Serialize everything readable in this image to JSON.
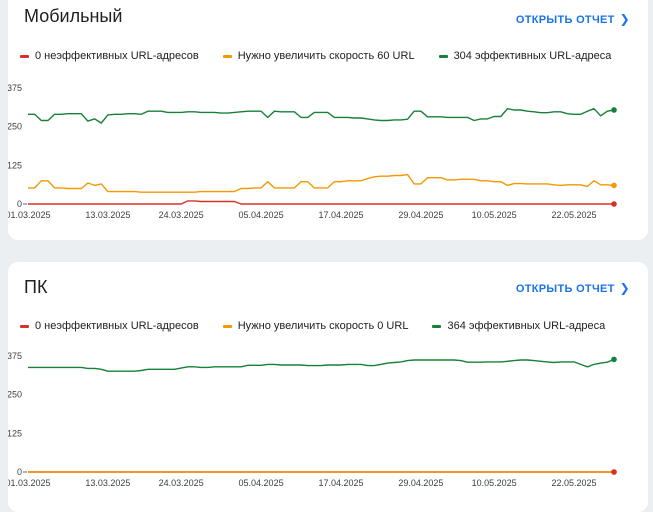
{
  "cards": [
    {
      "title": "Мобильный",
      "link_label": "ОТКРЫТЬ ОТЧЕТ",
      "legend": [
        {
          "label": "0 неэффективных URL-адресов",
          "color": "#d93025"
        },
        {
          "label": "Нужно увеличить скорость 60 URL",
          "color": "#f29900"
        },
        {
          "label": "304 эффективных URL-адреса",
          "color": "#188038"
        }
      ]
    },
    {
      "title": "ПК",
      "link_label": "ОТКРЫТЬ ОТЧЕТ",
      "legend": [
        {
          "label": "0 неэффективных URL-адресов",
          "color": "#d93025"
        },
        {
          "label": "Нужно увеличить скорость 0 URL",
          "color": "#f29900"
        },
        {
          "label": "364 эффективных URL-адреса",
          "color": "#188038"
        }
      ]
    }
  ],
  "chart_data": [
    {
      "type": "line",
      "ylim": [
        0,
        375
      ],
      "yticks": [
        "375",
        "250",
        "125",
        "0"
      ],
      "ytick_values": [
        375,
        250,
        125,
        0
      ],
      "x_tick_labels": [
        "01.03.2025",
        "13.03.2025",
        "24.03.2025",
        "05.04.2025",
        "17.04.2025",
        "29.04.2025",
        "10.05.2025",
        "22.05.2025"
      ],
      "x_tick_indices": [
        0,
        12,
        23,
        35,
        47,
        59,
        70,
        82
      ],
      "grid": false,
      "series": [
        {
          "name": "0 неэффективных URL-адресов",
          "color": "#d93025",
          "values": [
            0,
            0,
            0,
            0,
            0,
            0,
            0,
            0,
            0,
            0,
            0,
            0,
            0,
            0,
            0,
            0,
            0,
            0,
            0,
            0,
            0,
            0,
            0,
            0,
            10,
            10,
            8,
            8,
            8,
            8,
            8,
            8,
            0,
            0,
            0,
            0,
            0,
            0,
            0,
            0,
            0,
            0,
            0,
            0,
            0,
            0,
            0,
            0,
            0,
            0,
            0,
            0,
            0,
            0,
            0,
            0,
            0,
            0,
            0,
            0,
            0,
            0,
            0,
            0,
            0,
            0,
            0,
            0,
            0,
            0,
            0,
            0,
            0,
            0,
            0,
            0,
            0,
            0,
            0,
            0,
            0,
            0,
            0,
            0,
            0,
            0,
            0,
            0,
            0
          ]
        },
        {
          "name": "Нужно увеличить скорость 60 URL",
          "color": "#f29900",
          "values": [
            52,
            52,
            75,
            75,
            52,
            52,
            50,
            50,
            50,
            68,
            60,
            65,
            40,
            40,
            40,
            40,
            40,
            38,
            38,
            38,
            38,
            38,
            38,
            38,
            38,
            38,
            40,
            40,
            40,
            40,
            40,
            40,
            50,
            50,
            52,
            52,
            72,
            52,
            52,
            52,
            52,
            72,
            72,
            52,
            52,
            52,
            72,
            72,
            75,
            75,
            75,
            82,
            88,
            90,
            90,
            92,
            92,
            95,
            65,
            65,
            85,
            85,
            85,
            78,
            78,
            80,
            80,
            80,
            75,
            75,
            72,
            72,
            60,
            66,
            66,
            65,
            65,
            65,
            65,
            62,
            60,
            62,
            62,
            62,
            57,
            75,
            62,
            62,
            60
          ]
        },
        {
          "name": "304 эффективных URL-адреса",
          "color": "#188038",
          "values": [
            290,
            290,
            270,
            270,
            290,
            290,
            292,
            292,
            292,
            268,
            275,
            262,
            288,
            290,
            290,
            292,
            292,
            290,
            300,
            300,
            300,
            296,
            296,
            296,
            298,
            298,
            296,
            296,
            296,
            294,
            294,
            296,
            298,
            300,
            300,
            300,
            280,
            300,
            298,
            298,
            298,
            280,
            280,
            296,
            296,
            296,
            280,
            280,
            280,
            278,
            278,
            275,
            272,
            270,
            270,
            272,
            272,
            274,
            300,
            300,
            282,
            282,
            282,
            280,
            280,
            280,
            280,
            270,
            275,
            275,
            283,
            283,
            308,
            304,
            304,
            300,
            298,
            295,
            295,
            298,
            298,
            292,
            290,
            290,
            300,
            308,
            285,
            300,
            304
          ]
        }
      ]
    },
    {
      "type": "line",
      "ylim": [
        0,
        375
      ],
      "yticks": [
        "375",
        "250",
        "125",
        "0"
      ],
      "ytick_values": [
        375,
        250,
        125,
        0
      ],
      "x_tick_labels": [
        "01.03.2025",
        "13.03.2025",
        "24.03.2025",
        "05.04.2025",
        "17.04.2025",
        "29.04.2025",
        "10.05.2025",
        "22.05.2025"
      ],
      "x_tick_indices": [
        0,
        12,
        23,
        35,
        47,
        59,
        70,
        82
      ],
      "grid": false,
      "series": [
        {
          "name": "0 неэффективных URL-адресов",
          "color": "#d93025",
          "values": [
            0,
            0,
            0,
            0,
            0,
            0,
            0,
            0,
            0,
            0,
            0,
            0,
            0,
            0,
            0,
            0,
            0,
            0,
            0,
            0,
            0,
            0,
            0,
            0,
            0,
            0,
            0,
            0,
            0,
            0,
            0,
            0,
            0,
            0,
            0,
            0,
            0,
            0,
            0,
            0,
            0,
            0,
            0,
            0,
            0,
            0,
            0,
            0,
            0,
            0,
            0,
            0,
            0,
            0,
            0,
            0,
            0,
            0,
            0,
            0,
            0,
            0,
            0,
            0,
            0,
            0,
            0,
            0,
            0,
            0,
            0,
            0,
            0,
            0,
            0,
            0,
            0,
            0,
            0,
            0,
            0,
            0,
            0,
            0,
            0,
            0,
            0,
            0,
            0
          ]
        },
        {
          "name": "Нужно увеличить скорость 0 URL",
          "color": "#f29900",
          "values": [
            0,
            0,
            0,
            0,
            0,
            0,
            0,
            0,
            0,
            0,
            0,
            0,
            0,
            0,
            0,
            0,
            0,
            0,
            0,
            0,
            0,
            0,
            0,
            0,
            0,
            0,
            0,
            0,
            0,
            0,
            0,
            0,
            0,
            0,
            0,
            0,
            0,
            0,
            0,
            0,
            0,
            0,
            0,
            0,
            0,
            0,
            0,
            0,
            0,
            0,
            0,
            0,
            0,
            0,
            0,
            0,
            0,
            0,
            0,
            0,
            0,
            0,
            0,
            0,
            0,
            0,
            0,
            0,
            0,
            0,
            0,
            0,
            0,
            0,
            0,
            0,
            0,
            0,
            0,
            0,
            0,
            0,
            0,
            0,
            0,
            0,
            0,
            0,
            0
          ]
        },
        {
          "name": "364 эффективных URL-адреса",
          "color": "#188038",
          "values": [
            338,
            338,
            338,
            338,
            338,
            338,
            338,
            338,
            338,
            335,
            335,
            332,
            326,
            326,
            326,
            326,
            326,
            328,
            332,
            332,
            332,
            332,
            332,
            336,
            340,
            340,
            338,
            338,
            340,
            340,
            340,
            340,
            340,
            345,
            345,
            345,
            348,
            348,
            346,
            346,
            346,
            346,
            344,
            344,
            344,
            346,
            346,
            346,
            348,
            348,
            348,
            344,
            344,
            348,
            352,
            354,
            356,
            360,
            362,
            362,
            362,
            362,
            362,
            362,
            362,
            360,
            355,
            355,
            355,
            356,
            356,
            356,
            358,
            360,
            362,
            362,
            360,
            358,
            356,
            354,
            356,
            356,
            356,
            348,
            340,
            348,
            352,
            355,
            364
          ]
        }
      ]
    }
  ]
}
